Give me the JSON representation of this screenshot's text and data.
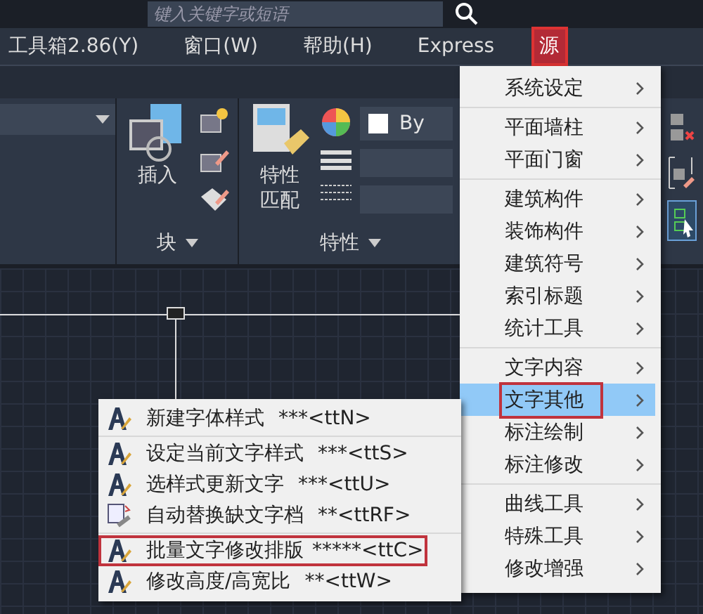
{
  "title_bar": {
    "search": {
      "placeholder": "键入关键字或短语"
    }
  },
  "menu_bar": [
    {
      "label": "工具箱2.86(Y)",
      "selected": false
    },
    {
      "label": "窗口(W)",
      "selected": false
    },
    {
      "label": "帮助(H)",
      "selected": false
    },
    {
      "label": "Express",
      "selected": false
    },
    {
      "label": "源",
      "selected": true
    }
  ],
  "ribbon": {
    "panels": [
      {
        "label": "块",
        "button": "插入"
      },
      {
        "label": "特性",
        "button": "特性匹配",
        "color_value": "By"
      }
    ]
  },
  "menu": {
    "groups": [
      [
        {
          "label": "系统设定",
          "selected": false,
          "marked": false
        }
      ],
      [
        {
          "label": "平面墙柱",
          "selected": false,
          "marked": false
        },
        {
          "label": "平面门窗",
          "selected": false,
          "marked": false
        }
      ],
      [
        {
          "label": "建筑构件",
          "selected": false,
          "marked": false
        },
        {
          "label": "装饰构件",
          "selected": false,
          "marked": false
        },
        {
          "label": "建筑符号",
          "selected": false,
          "marked": false
        },
        {
          "label": "索引标题",
          "selected": false,
          "marked": false
        },
        {
          "label": "统计工具",
          "selected": false,
          "marked": false
        }
      ],
      [
        {
          "label": "文字内容",
          "selected": false,
          "marked": false
        },
        {
          "label": "文字其他",
          "selected": true,
          "marked": true
        },
        {
          "label": "标注绘制",
          "selected": false,
          "marked": false
        },
        {
          "label": "标注修改",
          "selected": false,
          "marked": false
        }
      ],
      [
        {
          "label": "曲线工具",
          "selected": false,
          "marked": false
        },
        {
          "label": "特殊工具",
          "selected": false,
          "marked": false
        },
        {
          "label": "修改增强",
          "selected": false,
          "marked": false
        }
      ]
    ]
  },
  "submenu": {
    "groups": [
      [
        {
          "label": "新建字体样式",
          "shortcut": "***<ttN>",
          "kind": "text",
          "marked": false
        }
      ],
      [
        {
          "label": "设定当前文字样式",
          "shortcut": "***<ttS>",
          "kind": "text",
          "marked": false
        },
        {
          "label": "选样式更新文字",
          "shortcut": "***<ttU>",
          "kind": "text",
          "marked": false
        },
        {
          "label": "自动替换缺文字档",
          "shortcut": "**<ttRF>",
          "kind": "document",
          "marked": false
        }
      ],
      [
        {
          "label": "批量文字修改排版",
          "shortcut": "*****<ttC>",
          "kind": "text",
          "marked": true
        },
        {
          "label": "修改高度/高宽比",
          "shortcut": "**<ttW>",
          "kind": "text",
          "marked": false
        }
      ]
    ]
  }
}
